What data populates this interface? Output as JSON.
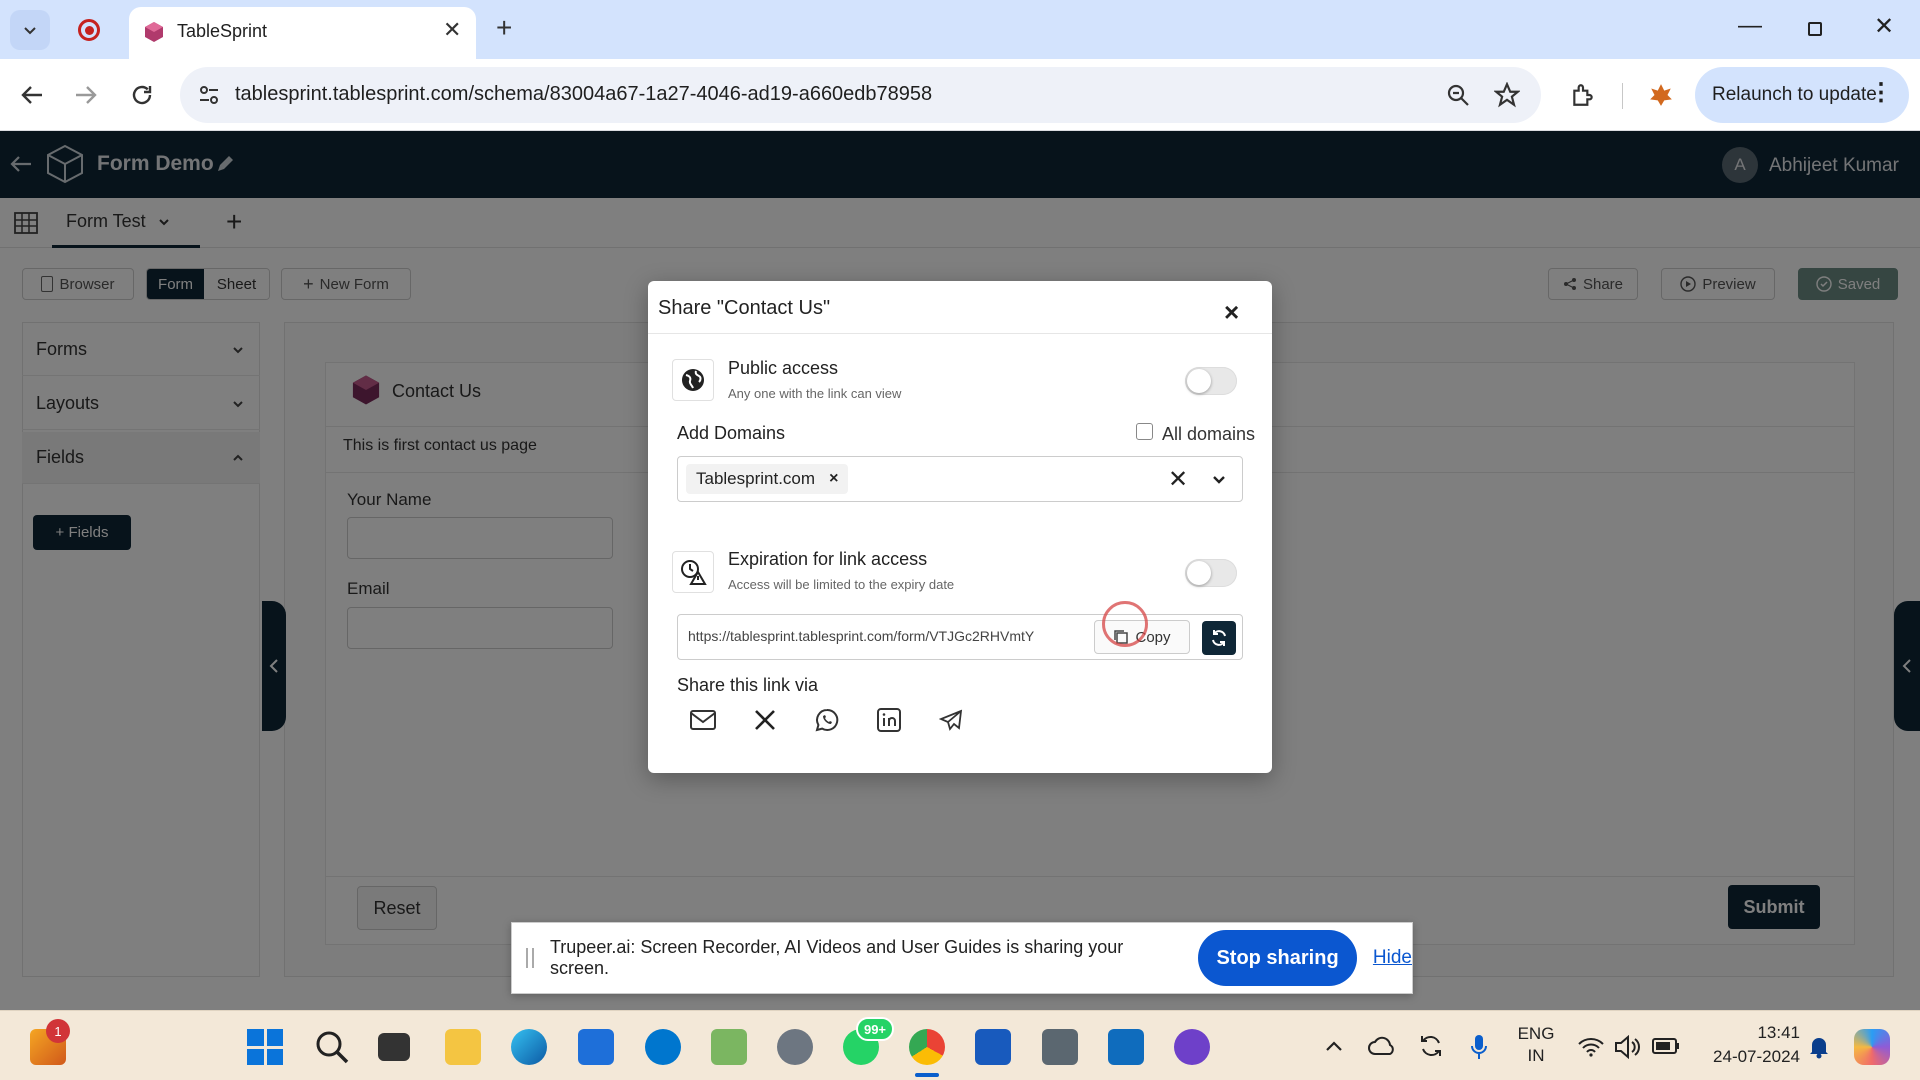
{
  "browser": {
    "tab_title": "TableSprint",
    "url": "tablesprint.tablesprint.com/schema/83004a67-1a27-4046-ad19-a660edb78958",
    "relaunch_label": "Relaunch to update"
  },
  "app": {
    "title": "Form Demo",
    "user_initial": "A",
    "user_name": "Abhijeet Kumar",
    "table_tab": "Form Test",
    "view_buttons": {
      "browser": "Browser",
      "form": "Form",
      "sheet": "Sheet",
      "new_form": "New Form"
    },
    "action_buttons": {
      "share": "Share",
      "preview": "Preview",
      "saved": "Saved"
    },
    "sidebar": {
      "items": [
        {
          "label": "Forms"
        },
        {
          "label": "Layouts"
        },
        {
          "label": "Fields"
        }
      ],
      "add_fields_label": "+ Fields"
    },
    "form": {
      "title": "Contact Us",
      "description": "This is first contact us page",
      "fields": [
        {
          "label": "Your Name"
        },
        {
          "label": "Email"
        }
      ],
      "reset_label": "Reset",
      "submit_label": "Submit"
    }
  },
  "modal": {
    "title": "Share \"Contact Us\"",
    "close": "×",
    "public_access": {
      "title": "Public access",
      "subtitle": "Any one with the link can view",
      "enabled": false
    },
    "add_domains_label": "Add Domains",
    "all_domains_label": "All domains",
    "domain_chip": "Tablesprint.com",
    "expiration": {
      "title": "Expiration for link access",
      "subtitle": "Access will be limited to the expiry date",
      "enabled": false
    },
    "link_url": "https://tablesprint.tablesprint.com/form/VTJGc2RHVmtY",
    "copy_label": "Copy",
    "share_via_label": "Share this link via",
    "share_icons": [
      "mail-icon",
      "x-icon",
      "whatsapp-icon",
      "linkedin-icon",
      "telegram-icon"
    ]
  },
  "notification": {
    "text": "Trupeer.ai: Screen Recorder, AI Videos and User Guides is sharing your screen.",
    "stop_label": "Stop sharing",
    "hide_label": "Hide"
  },
  "taskbar": {
    "widgets_badge": "1",
    "whatsapp_badge": "99+",
    "lang_line1": "ENG",
    "lang_line2": "IN",
    "time": "13:41",
    "date": "24-07-2024"
  },
  "colors": {
    "header": "#0f2737",
    "primary": "#0f2737",
    "accent_blue": "#0b57d0",
    "chrome_tab_bar": "#d3e3fd"
  }
}
